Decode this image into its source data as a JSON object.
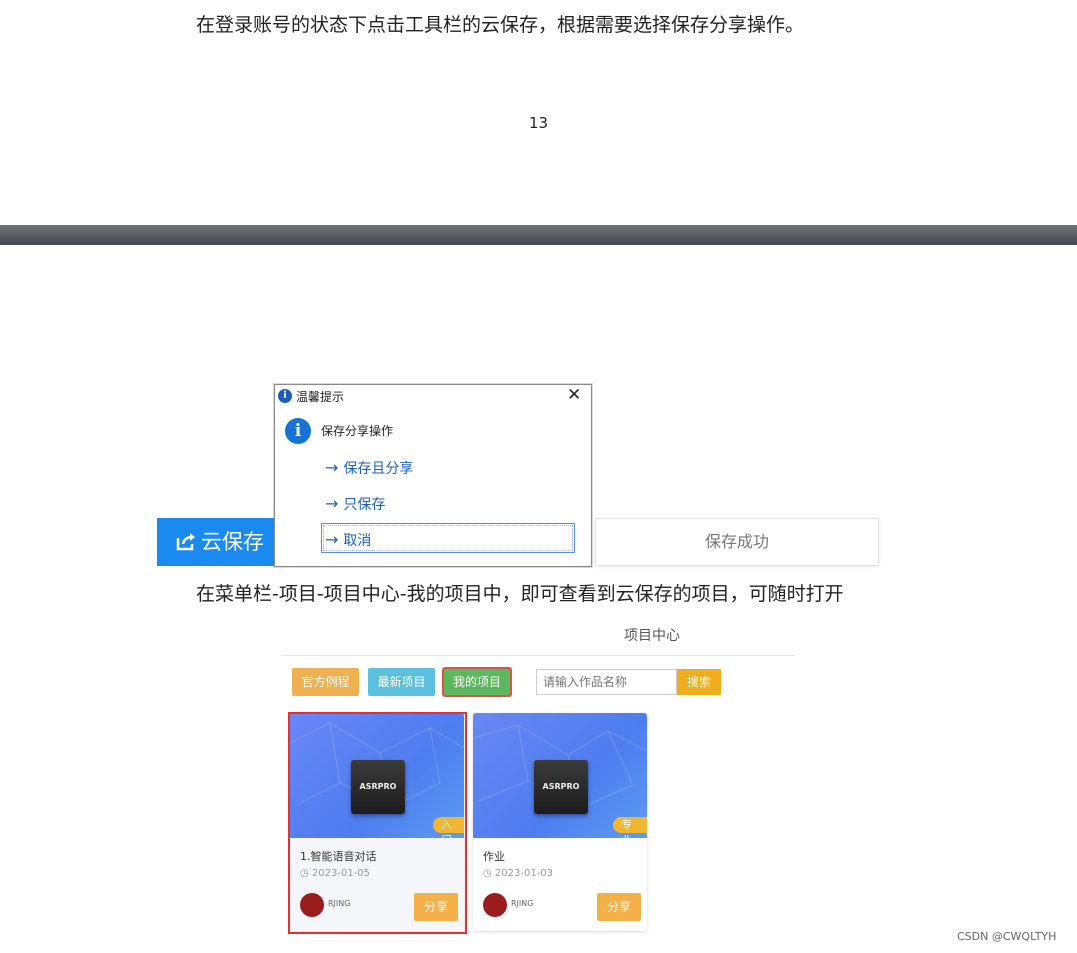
{
  "doc": {
    "instruction_top": "在登录账号的状态下点击工具栏的云保存，根据需要选择保存分享操作。",
    "page_number": "13",
    "instruction_bottom": "在菜单栏-项目-项目中心-我的项目中，即可查看到云保存的项目，可随时打开"
  },
  "dialog": {
    "title": "温馨提示",
    "close": "✕",
    "heading": "保存分享操作",
    "options": [
      "保存且分享",
      "只保存",
      "取消"
    ]
  },
  "toolbar": {
    "cloud_save_label": "云保存",
    "status": "保存成功"
  },
  "project_center": {
    "title": "项目中心",
    "tabs": [
      "官方例程",
      "最新项目",
      "我的项目"
    ],
    "search_placeholder": "请输入作品名称",
    "search_button": "搜索",
    "cards": [
      {
        "chip_text": "ASRPRO",
        "level": "入门",
        "name": "1.智能语音对话",
        "date": "2023-01-05",
        "author": "RJING",
        "share": "分享"
      },
      {
        "chip_text": "ASRPRO",
        "level": "专业",
        "name": "作业",
        "date": "2023-01-03",
        "author": "RJING",
        "share": "分享"
      }
    ]
  },
  "watermark": "CSDN @CWQLTYH",
  "colors": {
    "accent_blue": "#1a8af0",
    "tab_orange": "#f1b04f",
    "tab_cyan": "#5bc0de",
    "tab_green": "#5cb85c",
    "highlight_red": "#e0332f"
  }
}
